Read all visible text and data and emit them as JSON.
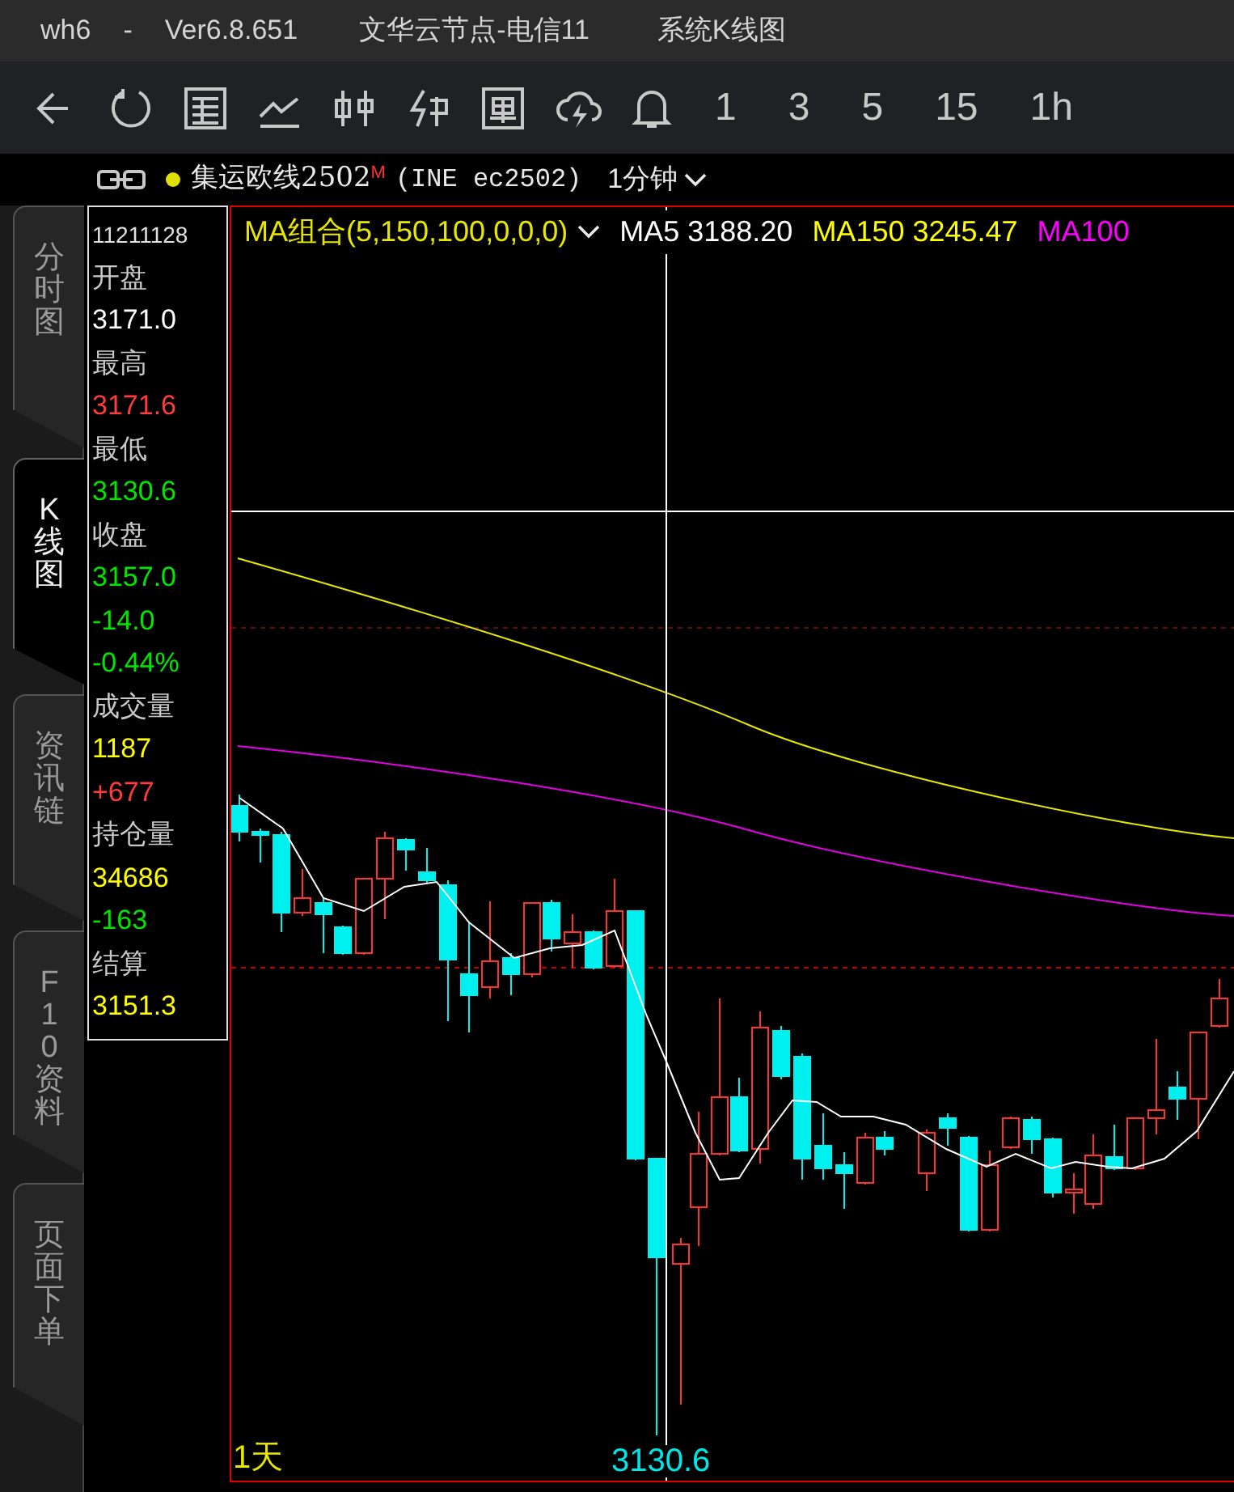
{
  "window": {
    "app": "wh6",
    "separator": "-",
    "version": "Ver6.8.651",
    "server": "文华云节点-电信11",
    "view": "系统K线图"
  },
  "toolbar": {
    "periods": [
      "1",
      "3",
      "5",
      "15",
      "1h"
    ]
  },
  "symbol_bar": {
    "name": "集运欧线2502",
    "mark": "M",
    "code": "(INE ec2502)",
    "period": "1分钟"
  },
  "side_tabs": [
    {
      "label": "分时图",
      "selected": false
    },
    {
      "label": "K线图",
      "selected": true
    },
    {
      "label": "资讯链",
      "selected": false
    },
    {
      "label": "F10资料",
      "selected": false
    },
    {
      "label": "页面下单",
      "selected": false
    }
  ],
  "info_lines": [
    {
      "text": "11211128",
      "color": "#e0e0e0"
    },
    {
      "text": "开盘",
      "color": "#c8c8c8"
    },
    {
      "text": "3171.0",
      "color": "#ffffff"
    },
    {
      "text": "最高",
      "color": "#c8c8c8"
    },
    {
      "text": "3171.6",
      "color": "#ff3c3c"
    },
    {
      "text": "最低",
      "color": "#c8c8c8"
    },
    {
      "text": "3130.6",
      "color": "#00e600"
    },
    {
      "text": "收盘",
      "color": "#c8c8c8"
    },
    {
      "text": "3157.0",
      "color": "#00e600"
    },
    {
      "text": "-14.0",
      "color": "#00e600"
    },
    {
      "text": "-0.44%",
      "color": "#00e600"
    },
    {
      "text": "成交量",
      "color": "#c8c8c8"
    },
    {
      "text": "1187",
      "color": "#ffff00"
    },
    {
      "text": "+677",
      "color": "#ff3c3c"
    },
    {
      "text": "持仓量",
      "color": "#c8c8c8"
    },
    {
      "text": "34686",
      "color": "#ffff00"
    },
    {
      "text": "-163",
      "color": "#00e600"
    },
    {
      "text": "结算",
      "color": "#c8c8c8"
    },
    {
      "text": "3151.3",
      "color": "#ffff00"
    }
  ],
  "chart": {
    "ma_group": "MA组合(5,150,100,0,0,0)",
    "legend": [
      {
        "text": "MA5 3188.20",
        "color": "#ffffff"
      },
      {
        "text": "MA150 3245.47",
        "color": "#ffff00"
      },
      {
        "text": "MA100",
        "color": "#ff00ff"
      }
    ],
    "period_label": "1天",
    "low_label": "3130.6"
  }
}
